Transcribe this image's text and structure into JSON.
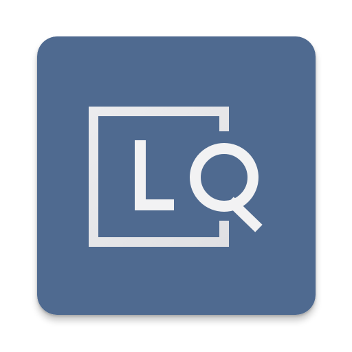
{
  "app_icon": {
    "name": "LQ",
    "letters": [
      "L",
      "Q"
    ]
  },
  "colors": {
    "tile_background": "#4f6a90",
    "glyph": "#f2f2f3",
    "frame": "#e6e6e8"
  }
}
